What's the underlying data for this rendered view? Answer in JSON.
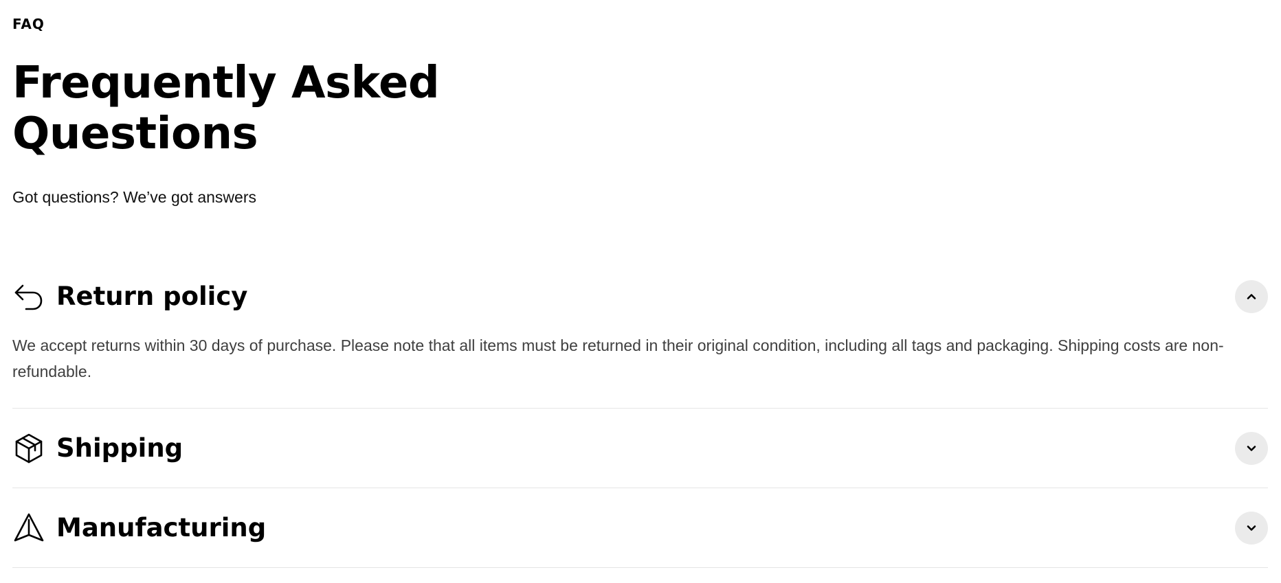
{
  "eyebrow": "FAQ",
  "page_title": "Frequently Asked Questions",
  "subtitle": "Got questions? We’ve got answers",
  "faq": {
    "items": [
      {
        "title": "Return policy",
        "icon": "return-arrow-icon",
        "expanded": true,
        "answer": "We accept returns within 30 days of purchase. Please note that all items must be returned in their original condition, including all tags and packaging. Shipping costs are non-refundable."
      },
      {
        "title": "Shipping",
        "icon": "package-box-icon",
        "expanded": false
      },
      {
        "title": "Manufacturing",
        "icon": "navigation-arrow-icon",
        "expanded": false
      }
    ]
  },
  "colors": {
    "text": "#000000",
    "answer_text": "#3f3f3f",
    "divider": "#e5e5e5",
    "toggle_bg": "#ebebeb"
  }
}
